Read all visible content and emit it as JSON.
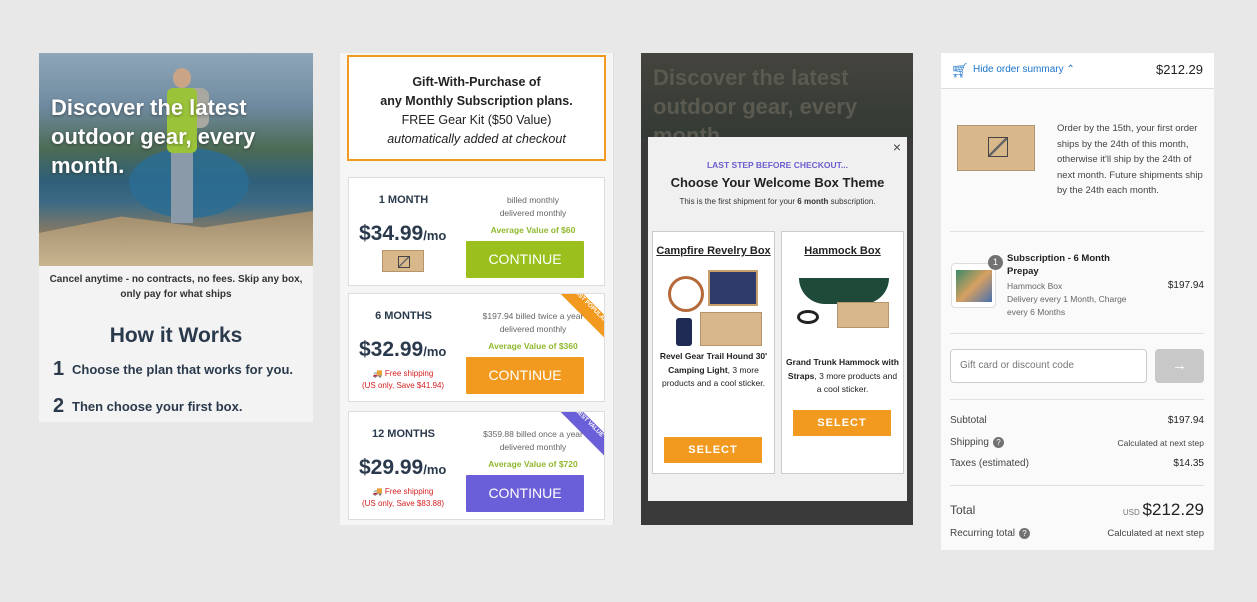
{
  "panel1": {
    "headline": "Discover the latest outdoor gear, every month.",
    "cancel_text": "Cancel anytime - no contracts, no fees. Skip any box, only pay for what ships",
    "how_title": "How it Works",
    "steps": [
      {
        "num": "1",
        "text": "Choose the plan that works for you."
      },
      {
        "num": "2",
        "text": "Then choose your first box."
      }
    ]
  },
  "panel2": {
    "gift": {
      "line1": "Gift-With-Purchase of",
      "line2": "any Monthly Subscription plans.",
      "line3": "FREE Gear Kit ($50 Value)",
      "line4": "automatically added at checkout"
    },
    "plans": [
      {
        "term": "1 MONTH",
        "price": "$34.99",
        "unit": "/mo",
        "billed1": "billed monthly",
        "billed2": "delivered monthly",
        "avg": "Average Value of $60",
        "cta": "CONTINUE",
        "ship1": "",
        "ship2": "",
        "ribbon": "",
        "color": "#9bc01e"
      },
      {
        "term": "6 MONTHS",
        "price": "$32.99",
        "unit": "/mo",
        "billed1": "$197.94 billed twice a year",
        "billed2": "delivered monthly",
        "avg": "Average Value of $360",
        "cta": "CONTINUE",
        "ship1": "Free shipping",
        "ship2": "(US only, Save $41.94)",
        "ribbon": "MOST POPULAR",
        "color": "#f29a1f"
      },
      {
        "term": "12 MONTHS",
        "price": "$29.99",
        "unit": "/mo",
        "billed1": "$359.88 billed once a year",
        "billed2": "delivered monthly",
        "avg": "Average Value of $720",
        "cta": "CONTINUE",
        "ship1": "Free shipping",
        "ship2": "(US only, Save $83.88)",
        "ribbon": "BEST VALUE",
        "color": "#6a5fd8"
      }
    ]
  },
  "panel3": {
    "bg_headline": "Discover the latest outdoor gear, every month.",
    "eyebrow": "LAST STEP BEFORE CHECKOUT...",
    "title": "Choose Your Welcome Box Theme",
    "subtitle_pre": "This is the first shipment for your ",
    "subtitle_bold": "6 month",
    "subtitle_post": " subscription.",
    "close_glyph": "×",
    "themes": [
      {
        "name": "Campfire Revelry Box",
        "desc_bold": "Revel Gear Trail Hound 30' Camping Light",
        "desc_rest": ", 3 more products and a cool sticker.",
        "cta": "SELECT"
      },
      {
        "name": "Hammock Box",
        "desc_bold": "Grand Trunk Hammock with Straps",
        "desc_rest": ", 3 more products and a cool sticker.",
        "cta": "SELECT"
      }
    ]
  },
  "panel4": {
    "hide_label": "Hide order summary",
    "chevron": "⌃",
    "header_total": "$212.29",
    "ship_note": "Order by the 15th, your first order ships by the 24th of this month, otherwise it'll ship by the 24th of next month. Future shipments ship by the 24th each month.",
    "item": {
      "qty": "1",
      "title": "Subscription - 6 Month Prepay",
      "variant": "Hammock Box",
      "delivery": "Delivery every 1 Month, Charge every 6 Months",
      "price": "$197.94"
    },
    "discount_placeholder": "Gift card or discount code",
    "apply_glyph": "→",
    "subtotal_label": "Subtotal",
    "subtotal_value": "$197.94",
    "shipping_label": "Shipping",
    "shipping_value": "Calculated at next step",
    "taxes_label": "Taxes (estimated)",
    "taxes_value": "$14.35",
    "total_label": "Total",
    "currency": "USD",
    "total_value": "$212.29",
    "recurring_label": "Recurring total",
    "recurring_value": "Calculated at next step"
  }
}
